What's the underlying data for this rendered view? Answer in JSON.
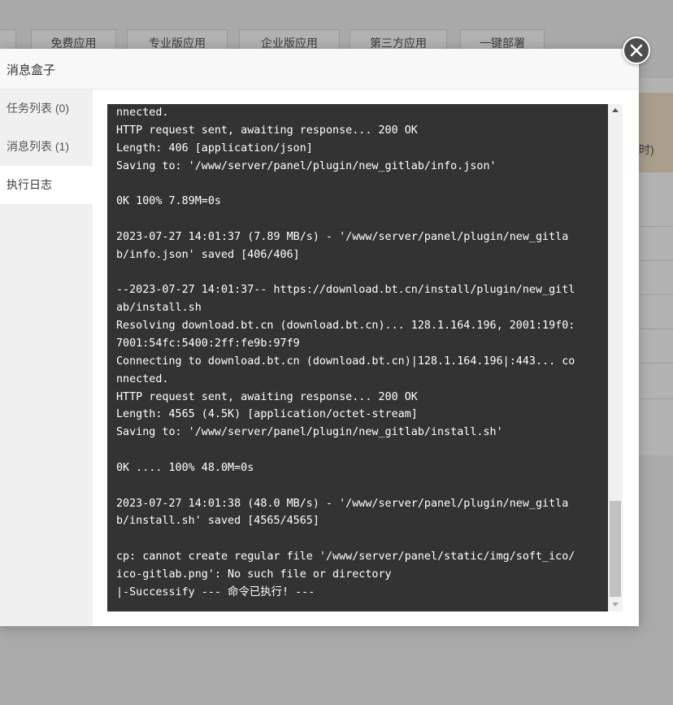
{
  "background": {
    "tabs": [
      "免费应用",
      "专业版应用",
      "企业版应用",
      "第三方应用",
      "一键部署"
    ],
    "partial_text": "时)"
  },
  "modal": {
    "title": "消息盒子",
    "sidebar": [
      {
        "label": "任务列表 (0)",
        "active": false
      },
      {
        "label": "消息列表 (1)",
        "active": false
      },
      {
        "label": "执行日志",
        "active": true
      }
    ],
    "log_lines": [
      "nnected.",
      "HTTP request sent, awaiting response... 200 OK",
      "Length: 406 [application/json]",
      "Saving to: '/www/server/panel/plugin/new_gitlab/info.json'",
      "",
      "0K 100% 7.89M=0s",
      "",
      "2023-07-27 14:01:37 (7.89 MB/s) - '/www/server/panel/plugin/new_gitla",
      "b/info.json' saved [406/406]",
      "",
      "--2023-07-27 14:01:37-- https://download.bt.cn/install/plugin/new_gitl",
      "ab/install.sh",
      "Resolving download.bt.cn (download.bt.cn)... 128.1.164.196, 2001:19f0:",
      "7001:54fc:5400:2ff:fe9b:97f9",
      "Connecting to download.bt.cn (download.bt.cn)|128.1.164.196|:443... co",
      "nnected.",
      "HTTP request sent, awaiting response... 200 OK",
      "Length: 4565 (4.5K) [application/octet-stream]",
      "Saving to: '/www/server/panel/plugin/new_gitlab/install.sh'",
      "",
      "0K .... 100% 48.0M=0s",
      "",
      "2023-07-27 14:01:38 (48.0 MB/s) - '/www/server/panel/plugin/new_gitla",
      "b/install.sh' saved [4565/4565]",
      "",
      "cp: cannot create regular file '/www/server/panel/static/img/soft_ico/",
      "ico-gitlab.png': No such file or directory",
      "|-Successify --- 命令已执行! ---"
    ]
  }
}
